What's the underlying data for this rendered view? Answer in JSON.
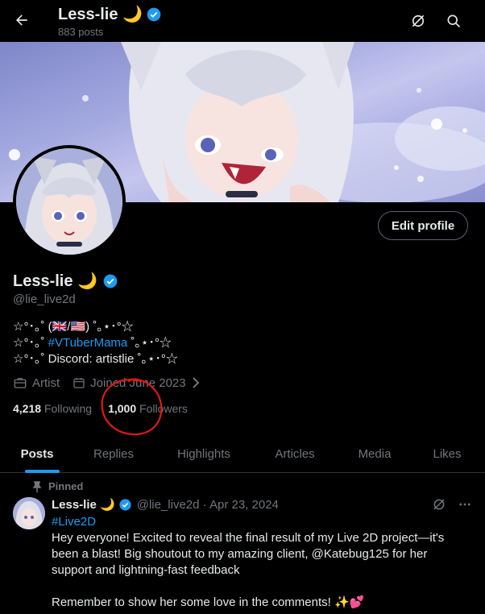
{
  "header": {
    "title": "Less-lie 🌙",
    "post_count": "883 posts"
  },
  "profile": {
    "display_name": "Less-lie 🌙",
    "handle": "@lie_live2d",
    "edit_button": "Edit profile",
    "bio_line1": "☆°･｡˚ (🇬🇧/🇺🇸) ˚｡⋆･°☆",
    "bio_line2_prefix": "☆°･｡˚ ",
    "bio_line2_link": "#VTuberMama",
    "bio_line2_suffix": " ˚｡⋆･°☆",
    "bio_line3": "☆°･｡˚ Discord: artistlie ˚｡⋆･°☆",
    "category": "Artist",
    "joined": "Joined June 2023",
    "following_count": "4,218",
    "following_label": "Following",
    "followers_count": "1,000",
    "followers_label": "Followers"
  },
  "tabs": [
    "Posts",
    "Replies",
    "Highlights",
    "Articles",
    "Media",
    "Likes"
  ],
  "post": {
    "pinned_label": "Pinned",
    "author": "Less-lie 🌙",
    "handle_date": "@lie_live2d · Apr 23, 2024",
    "hashtag": "#Live2D",
    "text1": "Hey everyone! Excited to reveal the final result of my Live 2D project—it's been a blast! Big shoutout to my amazing client, @Katebug125  for her support and lightning-fast feedback",
    "text2": "Remember to show her some love in the comments! ✨💕"
  },
  "colors": {
    "accent": "#1d9bf0",
    "background": "#000000",
    "muted": "#71767b",
    "annotation": "#e01818"
  }
}
